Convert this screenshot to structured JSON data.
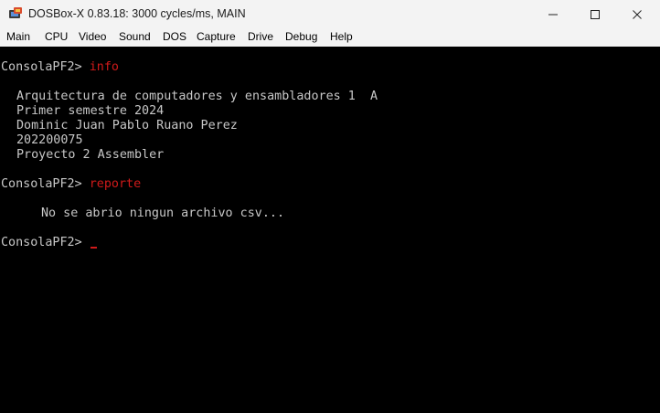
{
  "window": {
    "title": "DOSBox-X 0.83.18: 3000 cycles/ms, MAIN",
    "icon": "dosbox-icon",
    "controls": [
      "minimize-icon",
      "maximize-icon",
      "close-icon"
    ]
  },
  "menu": {
    "items": [
      "Main",
      "CPU",
      "Video",
      "Sound",
      "DOS",
      "Capture",
      "Drive",
      "Debug",
      "Help"
    ]
  },
  "console": {
    "prompt": "ConsolaPF2>",
    "commands": {
      "info": "info",
      "reporte": "reporte"
    },
    "info_lines": [
      "Arquitectura de computadores y ensambladores 1  A",
      "Primer semestre 2024",
      "Dominic Juan Pablo Ruano Perez",
      "202200075",
      "Proyecto 2 Assembler"
    ],
    "reporte_message": "No se abrio ningun archivo csv...",
    "colors": {
      "text": "#c8c8c8",
      "command": "#d01a1a",
      "background": "#000000"
    }
  }
}
